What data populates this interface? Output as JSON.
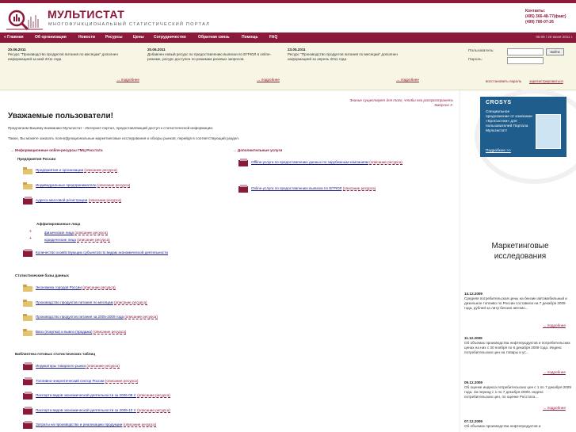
{
  "header": {
    "title": "МУЛЬТИСТАТ",
    "subtitle": "МНОГОФУНКЦИОНАЛЬНЫЙ СТАТИСТИЧЕСКИЙ ПОРТАЛ",
    "contacts_label": "Контакты:",
    "phone1": "(495) 366-48-77(факс)",
    "phone2": "(499) 780-07-26"
  },
  "nav": {
    "items": [
      "« Главная",
      "Об организации",
      "Новости",
      "Ресурсы",
      "Цены",
      "Сотрудничество",
      "Обратная связь",
      "Помощь",
      "FAQ"
    ],
    "date": "05:09 / 20 июня 2011 г."
  },
  "news": [
    {
      "date": "20.06.2011",
      "text": "Ресурс \"Производство продуктов питания по месяцам\" дополнен информацией за май 2011 года",
      "more": "→ подробнее"
    },
    {
      "date": "20.06.2011",
      "text": "Добавлен новый ресурс по предоставлению выписки по ЕГРЮЛ в online-режиме, ресурс доступен по режимам разовых запросов.",
      "more": "→ подробнее"
    },
    {
      "date": "23.05.2011",
      "text": "Ресурс \"Производство продуктов питания по месяцам\" дополнен информацией за апрель 2011 года",
      "more": "→ подробнее"
    }
  ],
  "login": {
    "user_label": "Пользователь:",
    "pass_label": "Пароль:",
    "button": "войти",
    "restore": "восстановить пароль",
    "register": "зарегистрироваться"
  },
  "main": {
    "quote1": "Знание существует для того, чтобы его распространять",
    "quote2": "Эмерсон У.",
    "title": "Уважаемые пользователи!",
    "intro1": "Предлагаем Вашему вниманию Мультистат - Интернат-портал, предоставляющий доступ к статистической информации.",
    "intro2": "Также, Вы можете заказать полнофункциональные маркетинговые исследования и обзоры рынков, перейдя в соответствующий раздел.",
    "sec_online": "→ Информационные online-ресурсы ГМЦ Росстата",
    "sec_extra": "→ Дополнительные услуги",
    "sub_registers": "Предприятия России",
    "sub_affil": "Аффилированные лица",
    "sub_stat": "Статистические базы данных",
    "sub_lib": "Библиотека готовых статистических таблиц",
    "desc": "(описание ресурса)",
    "res_registers": [
      "Предприятия и организации",
      "Индивидуальные предприниматели",
      "Адреса массовой регистрации"
    ],
    "res_affil": [
      "физические лица",
      "юридические лица"
    ],
    "res_count": "Количество хозяйствующих субъектов по видам экономической деятельности",
    "res_stat": [
      "Экономика городов России",
      "Производство продуктов питания по месяцам",
      "Производство продуктов питания за 2005-2009 года",
      "Ввоз (покупка) и вывоз (продажа)"
    ],
    "res_lib": [
      "Индикаторы товарного рынка",
      "Топливно-энергетический сектор России",
      "Паспорта видов экономической деятельности за 2006-08 гг",
      "Паспорта видов экономической деятельности за 2009-10 гг",
      "Затраты на производство и реализацию продукции"
    ],
    "res_extra": [
      "Offline-услуга по предоставлению данных по зарубежным компаниям",
      "Online-услуга по предоставлению выписки по ЕГРЮЛ"
    ]
  },
  "sidebar": {
    "banner_brand": "CROSYS",
    "banner_text": "Специальное предложение от компании «КроСистем» для пользователей Портала Мультистат!",
    "banner_more": "Подробнее >>",
    "marketing": "Маркетинговые исследования",
    "news": [
      {
        "date": "14.12.2009",
        "text": "Средняя потребительская цены на бензин автомобильный и дизельное топливо по России составили на 7 декабря 2009 года, рублей за литр бензин автомо...",
        "more": "→ подробнее"
      },
      {
        "date": "11.12.2009",
        "text": "Об объемах производства нефтепродуктов и потребительских ценах на них с 30 ноября по 6 декабря 2009 года. Индекс потребительских цен на товары и ус...",
        "more": "→ подробнее"
      },
      {
        "date": "09.12.2009",
        "text": "Об оценке индекса потребительских цен с 1 по 7 декабря 2009 года. За период с 1 по 7 декабря 2009г. индекс потребительских цен, по оценке Росстата...",
        "more": "→ подробнее"
      },
      {
        "date": "07.12.2009",
        "text": "Об объемах производства нефтепродуктов и",
        "more": ""
      }
    ]
  },
  "colors": {
    "brand": "#8b1a3a",
    "news_bg": "#f7f5e3",
    "banner": "#1f5e8c"
  }
}
